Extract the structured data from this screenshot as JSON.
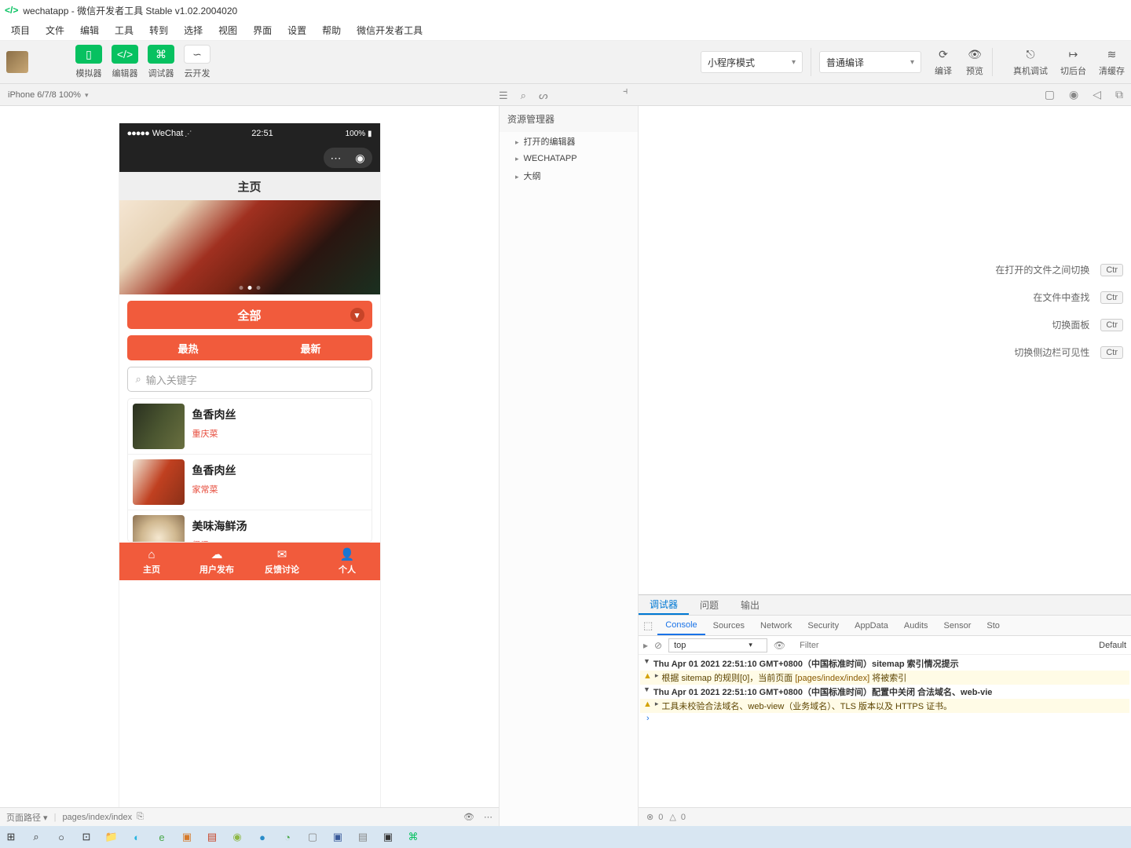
{
  "titlebar": {
    "title": "wechatapp - 微信开发者工具 Stable v1.02.2004020"
  },
  "menu": [
    "项目",
    "文件",
    "编辑",
    "工具",
    "转到",
    "选择",
    "视图",
    "界面",
    "设置",
    "帮助",
    "微信开发者工具"
  ],
  "toolbar": {
    "simulator": "模拟器",
    "editor": "编辑器",
    "debugger": "调试器",
    "cloud": "云开发",
    "mode": "小程序模式",
    "compile_mode": "普通编译",
    "compile": "编译",
    "preview": "预览",
    "remote": "真机调试",
    "background": "切后台",
    "clear": "清缓存"
  },
  "subbar": {
    "device": "iPhone 6/7/8 100%"
  },
  "explorer": {
    "title": "资源管理器",
    "items": [
      "打开的编辑器",
      "WECHATAPP",
      "大纲"
    ]
  },
  "hints": [
    {
      "label": "在打开的文件之间切换",
      "key": "Ctr"
    },
    {
      "label": "在文件中查找",
      "key": "Ctr"
    },
    {
      "label": "切换面板",
      "key": "Ctr"
    },
    {
      "label": "切换侧边栏可见性",
      "key": "Ctr"
    }
  ],
  "devtools": {
    "tabs1": [
      "调试器",
      "问题",
      "输出"
    ],
    "tabs2": [
      "Console",
      "Sources",
      "Network",
      "Security",
      "AppData",
      "Audits",
      "Sensor",
      "Sto"
    ],
    "scope": "top",
    "filter_placeholder": "Filter",
    "level": "Default",
    "lines": [
      {
        "type": "head",
        "text": "Thu Apr 01 2021 22:51:10 GMT+0800（中国标准时间）sitemap 索引情况提示"
      },
      {
        "type": "warn",
        "pre": "根据 sitemap 的规则[0]，当前页面 ",
        "link": "[pages/index/index]",
        "post": " 将被索引"
      },
      {
        "type": "head",
        "text": "Thu Apr 01 2021 22:51:10 GMT+0800（中国标准时间）配置中关闭 合法域名、web-vie"
      },
      {
        "type": "warn",
        "pre": "工具未校验合法域名、web-view（业务域名）、TLS 版本以及 HTTPS 证书。",
        "link": "",
        "post": ""
      }
    ],
    "status": {
      "errors": "0",
      "warnings": "0"
    }
  },
  "sim_status": {
    "label": "页面路径",
    "path": "pages/index/index"
  },
  "phone": {
    "carrier": "WeChat",
    "time": "22:51",
    "battery": "100%",
    "page_title": "主页",
    "category": "全部",
    "sort_hot": "最热",
    "sort_new": "最新",
    "search_placeholder": "输入关键字",
    "items": [
      {
        "name": "鱼香肉丝",
        "cat": "重庆菜"
      },
      {
        "name": "鱼香肉丝",
        "cat": "家常菜"
      },
      {
        "name": "美味海鲜汤",
        "cat": "煲汤"
      }
    ],
    "tabs": [
      "主页",
      "用户发布",
      "反馈讨论",
      "个人"
    ]
  }
}
